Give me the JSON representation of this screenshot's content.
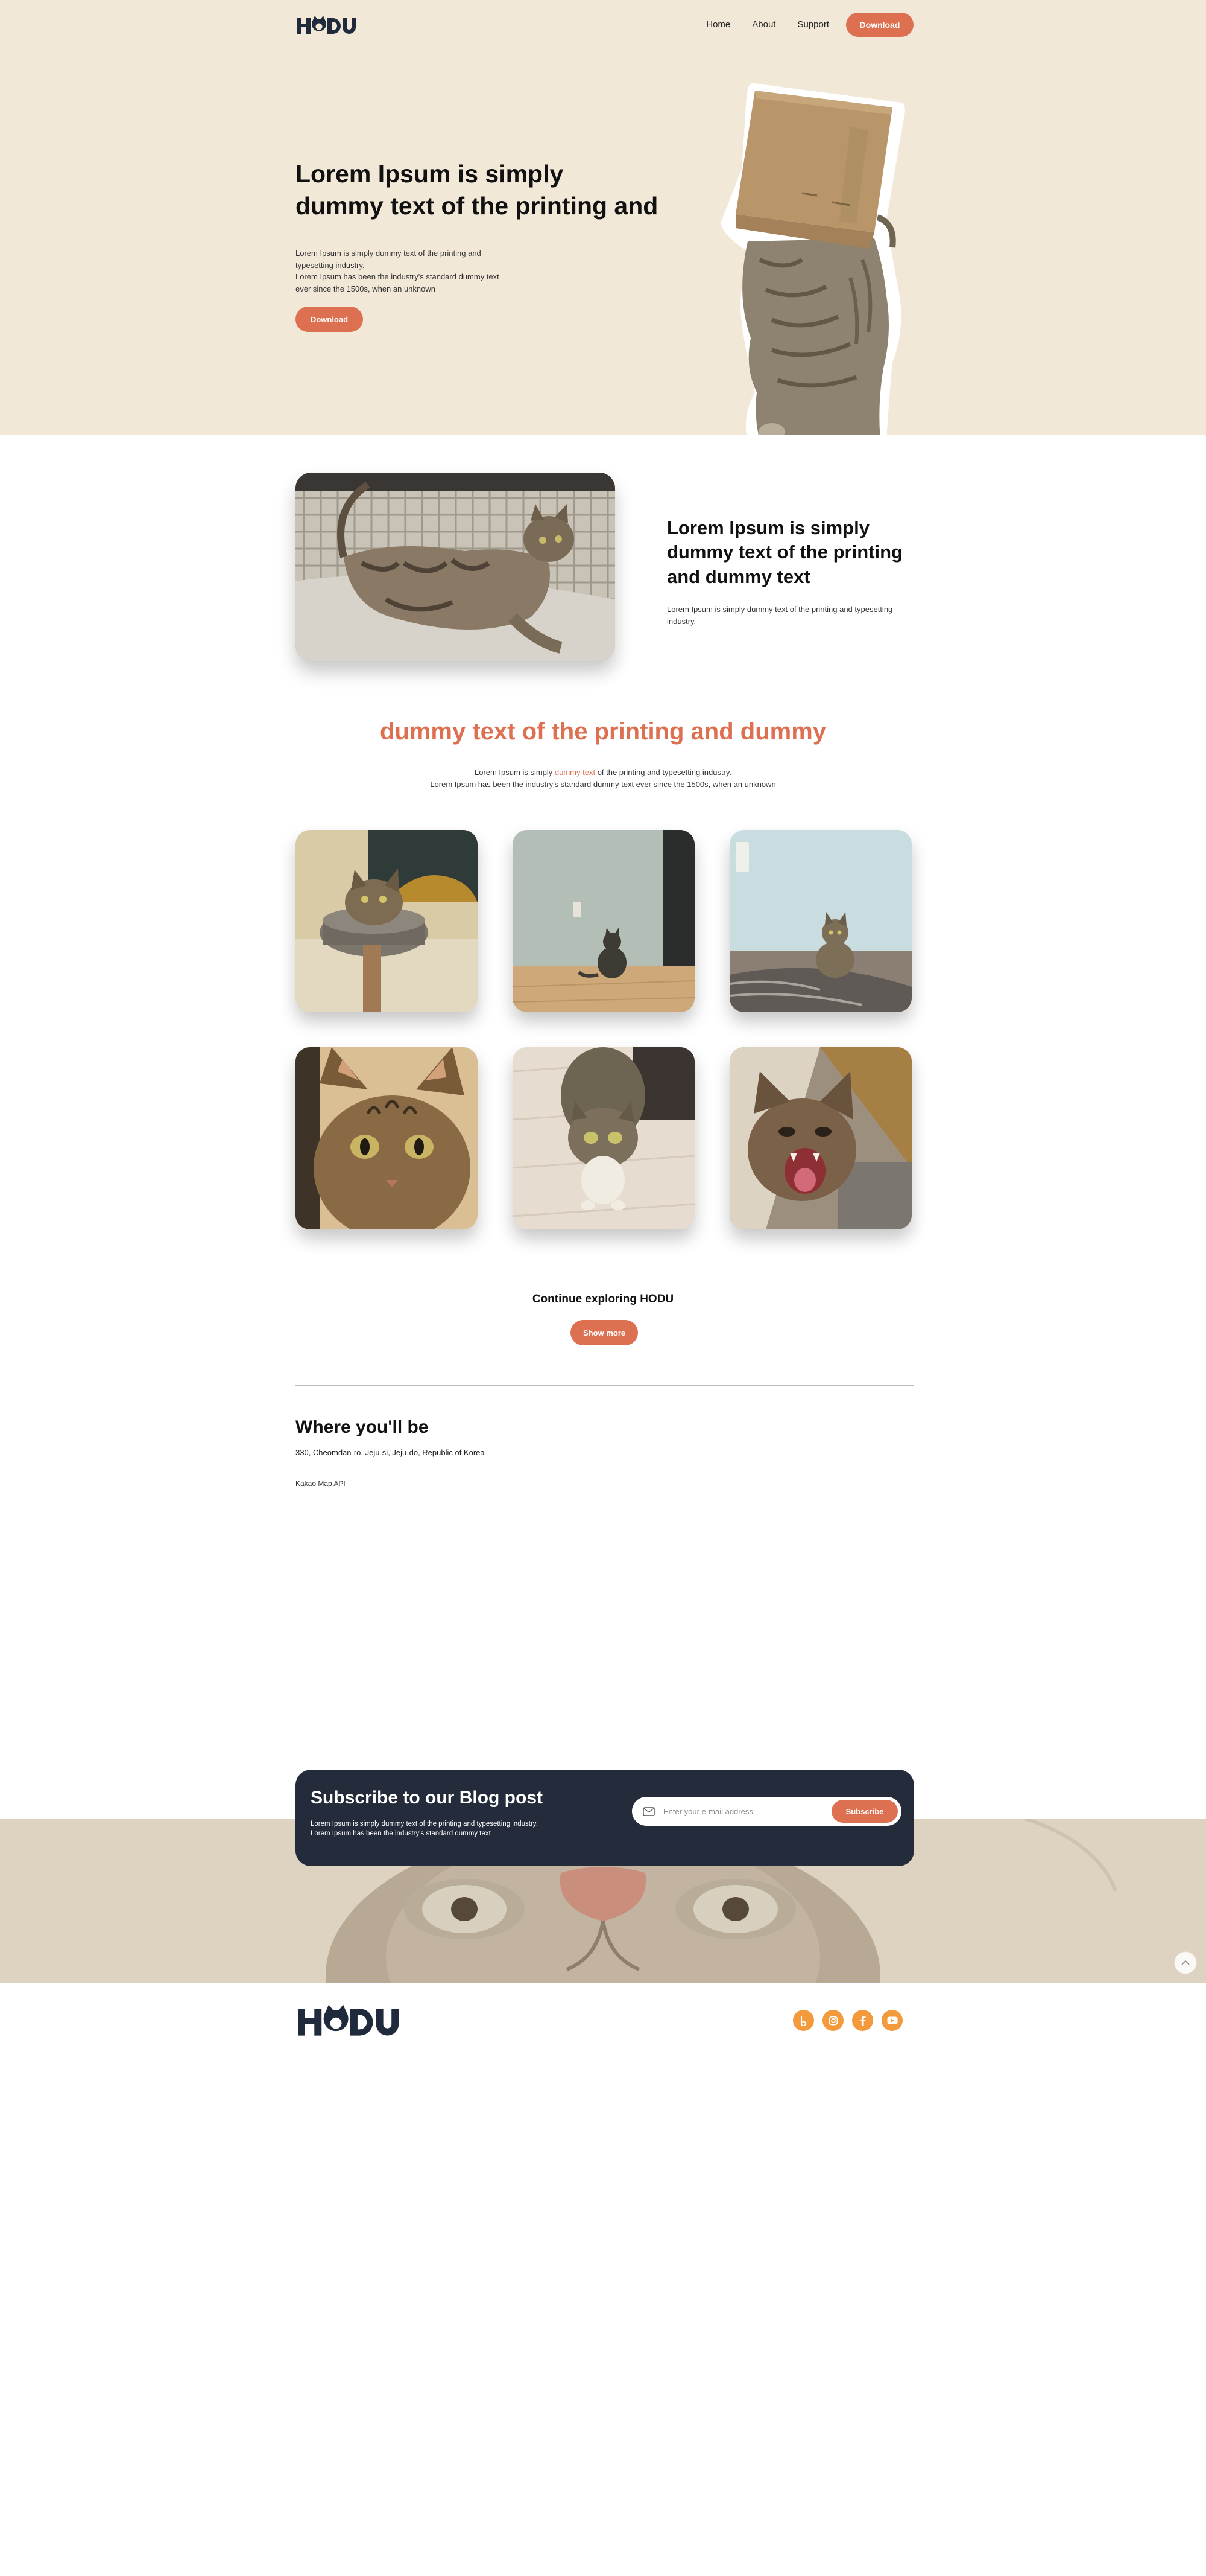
{
  "header": {
    "logo": "HODU",
    "nav": [
      "Home",
      "About",
      "Support"
    ],
    "download_label": "Download"
  },
  "hero": {
    "title_line1": "Lorem Ipsum is simply",
    "title_line2": "dummy text of the printing and",
    "desc_line1": "Lorem Ipsum is simply dummy text of the printing and",
    "desc_line2": "typesetting industry.",
    "desc_line3": "Lorem Ipsum has been the industry's standard dummy text",
    "desc_line4": "ever since the 1500s, when an unknown",
    "button_label": "Download"
  },
  "feature": {
    "title": "Lorem Ipsum is simply dummy text of the printing and dummy text",
    "desc": "Lorem Ipsum is simply dummy text of the printing and typesetting industry."
  },
  "gallery": {
    "title": "dummy text of the printing and dummy",
    "desc_pre": "Lorem Ipsum is simply ",
    "desc_highlight": "dummy text",
    "desc_post": " of the printing and typesetting industry.",
    "desc_line2": "Lorem Ipsum has been the industry's standard dummy text ever since the 1500s, when an unknown"
  },
  "explore": {
    "title": "Continue exploring HODU",
    "button_label": "Show more"
  },
  "location": {
    "title": "Where you'll be",
    "address": "330, Cheomdan-ro, Jeju-si, Jeju-do, Republic of Korea",
    "map_label": "Kakao Map API"
  },
  "subscribe": {
    "title": "Subscribe to our Blog post",
    "desc_line1": "Lorem Ipsum is simply dummy text of the printing and typesetting industry.",
    "desc_line2": "Lorem Ipsum has been the industry's standard dummy text",
    "placeholder": "Enter your e-mail address",
    "button_label": "Subscribe"
  },
  "footer": {
    "logo": "HODU",
    "social": [
      "blog-icon",
      "instagram-icon",
      "facebook-icon",
      "youtube-icon"
    ]
  },
  "colors": {
    "accent": "#dd7050",
    "hero_bg": "#f2e8d8",
    "dark": "#242c3b",
    "social": "#f29a3c"
  }
}
